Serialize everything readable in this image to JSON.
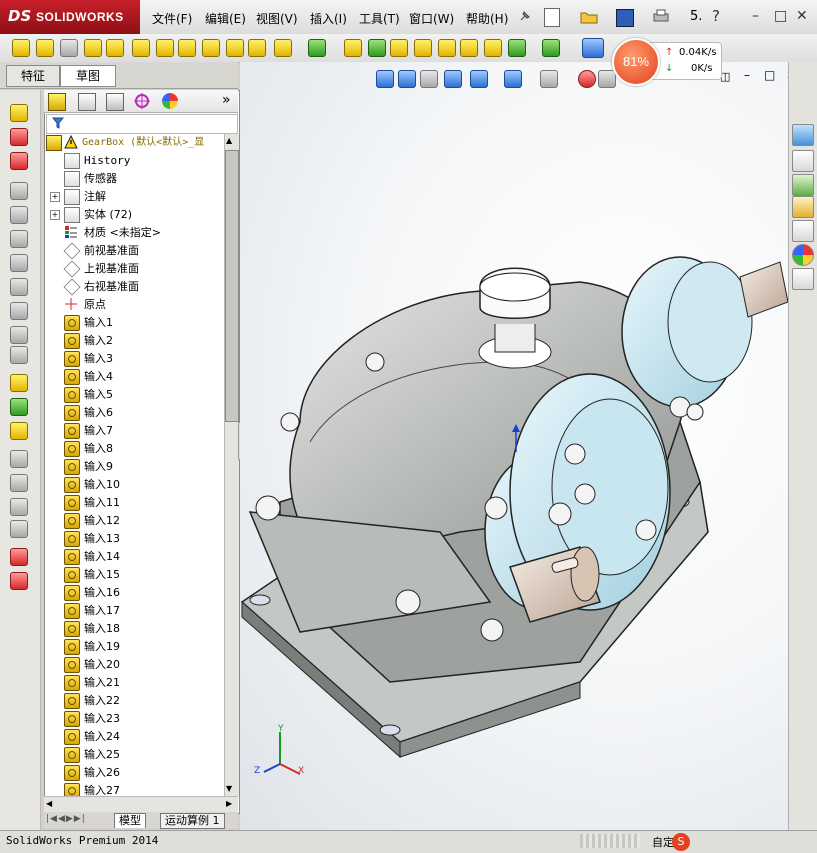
{
  "app": {
    "brand_prefix": "DS",
    "brand_name": "SOLIDWORKS",
    "brand_color": "#c8202a"
  },
  "menu": [
    "文件(F)",
    "编辑(E)",
    "视图(V)",
    "插入(I)",
    "工具(T)",
    "窗口(W)",
    "帮助(H)"
  ],
  "titlebar": {
    "overflow_label": "5."
  },
  "window_controls": {
    "minimize": "–",
    "maximize": "□",
    "close": "✕",
    "help": "?"
  },
  "network_widget": {
    "percent": "81%",
    "upload": "0.04K/s",
    "download": "0K/s",
    "up_arrow": "↑",
    "down_arrow": "↓"
  },
  "panel_tabs": {
    "feature": "特征",
    "sketch": "草图"
  },
  "feature_tree": {
    "root": "GearBox  (默认<默认>_显",
    "items": [
      {
        "label": "History",
        "icon": "history-icon"
      },
      {
        "label": "传感器",
        "icon": "sensor-icon"
      },
      {
        "label": "注解",
        "icon": "annotation-icon",
        "expand": "+"
      },
      {
        "label": "实体 (72)",
        "icon": "solid-bodies-icon",
        "expand": "+"
      },
      {
        "label": "材质 <未指定>",
        "icon": "material-icon"
      },
      {
        "label": "前视基准面",
        "icon": "plane-icon"
      },
      {
        "label": "上视基准面",
        "icon": "plane-icon"
      },
      {
        "label": "右视基准面",
        "icon": "plane-icon"
      },
      {
        "label": "原点",
        "icon": "origin-icon"
      },
      {
        "label": "输入1"
      },
      {
        "label": "输入2"
      },
      {
        "label": "输入3"
      },
      {
        "label": "输入4"
      },
      {
        "label": "输入5"
      },
      {
        "label": "输入6"
      },
      {
        "label": "输入7"
      },
      {
        "label": "输入8"
      },
      {
        "label": "输入9"
      },
      {
        "label": "输入10"
      },
      {
        "label": "输入11"
      },
      {
        "label": "输入12"
      },
      {
        "label": "输入13"
      },
      {
        "label": "输入14"
      },
      {
        "label": "输入15"
      },
      {
        "label": "输入16"
      },
      {
        "label": "输入17"
      },
      {
        "label": "输入18"
      },
      {
        "label": "输入19"
      },
      {
        "label": "输入20"
      },
      {
        "label": "输入21"
      },
      {
        "label": "输入22"
      },
      {
        "label": "输入23"
      },
      {
        "label": "输入24"
      },
      {
        "label": "输入25"
      },
      {
        "label": "输入26"
      },
      {
        "label": "输入27"
      }
    ]
  },
  "bottom_tabs": {
    "model": "模型",
    "motion": "运动算例 1"
  },
  "status": {
    "text": "SolidWorks Premium 2014",
    "right_text": "自定义"
  },
  "triad": {
    "x": "X",
    "y": "Y",
    "z": "Z"
  },
  "model_colors": {
    "housing": "#c8ccc8",
    "cover": "#c8e6f0",
    "shaft": "#e8d8c8"
  }
}
